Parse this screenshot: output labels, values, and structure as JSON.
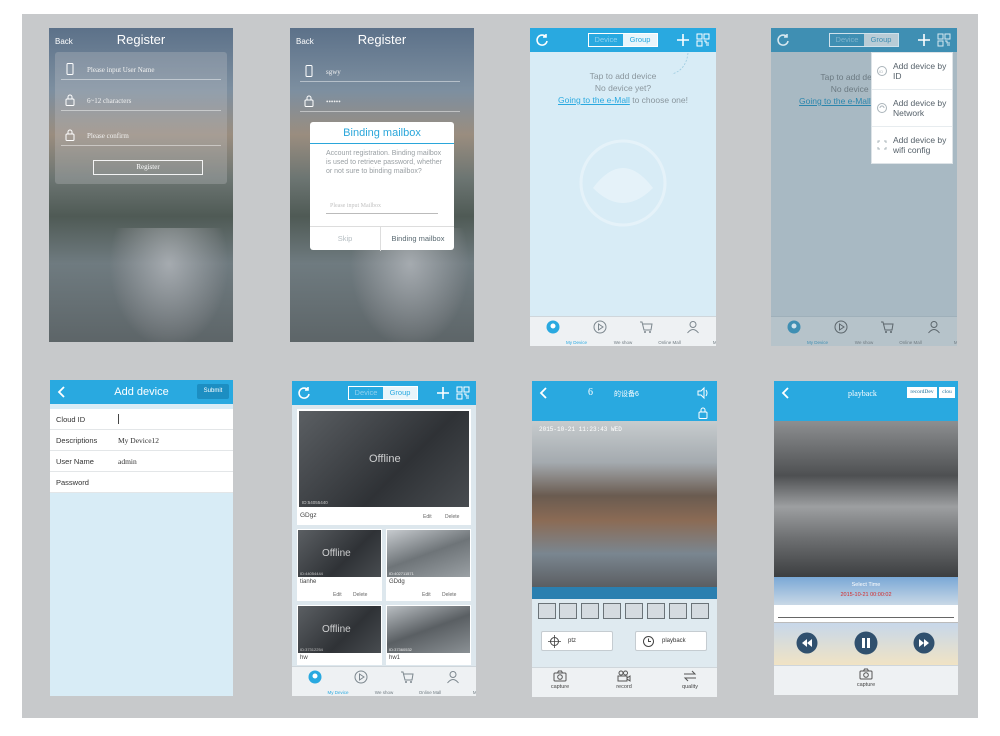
{
  "register1": {
    "back": "Back",
    "title": "Register",
    "username_placeholder": "Please input User Name",
    "password_placeholder": "6~12 characters",
    "confirm_placeholder": "Please confirm",
    "register_btn": "Register"
  },
  "register2": {
    "back": "Back",
    "title": "Register",
    "username_value": "sgwy",
    "password_value": "••••••",
    "dialog": {
      "title": "Binding mailbox",
      "text": "Account registration. Binding mailbox is used to retrieve password, whether or not sure to binding mailbox?",
      "input_placeholder": "Please input Mailbox",
      "skip": "Skip",
      "bind": "Binding mailbox"
    }
  },
  "devices_empty": {
    "seg_device": "Device",
    "seg_group": "Group",
    "line1": "Tap to add device",
    "line2": "No device yet?",
    "link": "Going to the e-Mall",
    "line3_suffix": "to choose one!"
  },
  "devices_menu": {
    "seg_device": "Device",
    "seg_group": "Group",
    "line1": "Tap to add device",
    "line2": "No device yet?",
    "link": "Going to the e-Mall",
    "items": [
      "Add device by ID",
      "Add device by Network",
      "Add device by wifi config"
    ]
  },
  "tabs": [
    "My Device",
    "We show",
    "Online Mall",
    "Me"
  ],
  "add_device": {
    "title": "Add device",
    "submit": "Submit",
    "rows": [
      {
        "label": "Cloud ID",
        "value": ""
      },
      {
        "label": "Descriptions",
        "value": "My Device12"
      },
      {
        "label": "User Name",
        "value": "admin"
      },
      {
        "label": "Password",
        "value": ""
      }
    ]
  },
  "device_list": {
    "seg_device": "Device",
    "seg_group": "Group",
    "offline": "Offline",
    "edit": "Edit",
    "delete": "Delete",
    "devices": [
      {
        "name": "GDgz",
        "id": "ID:54055440",
        "status": "Offline"
      },
      {
        "name": "tianhe",
        "id": "ID:44054444",
        "status": "Offline"
      },
      {
        "name": "GDdg",
        "id": "ID:402711571",
        "status": ""
      },
      {
        "name": "hw",
        "id": "ID:37312254",
        "status": "Offline"
      },
      {
        "name": "hw1",
        "id": "ID:37360532",
        "status": ""
      }
    ]
  },
  "live_view": {
    "channel": "6",
    "device_name": "的设备6",
    "timestamp": "2015-10-21 11:23:43 WED",
    "ptz": "ptz",
    "playback": "playback",
    "tools": [
      "capture",
      "record",
      "quality"
    ]
  },
  "playback": {
    "title": "playback",
    "record_btn": "recordDev",
    "cloud_btn": "clou",
    "select_time": "Select Time",
    "time_value": "2015-10-21 00:00:02",
    "capture": "capture"
  }
}
